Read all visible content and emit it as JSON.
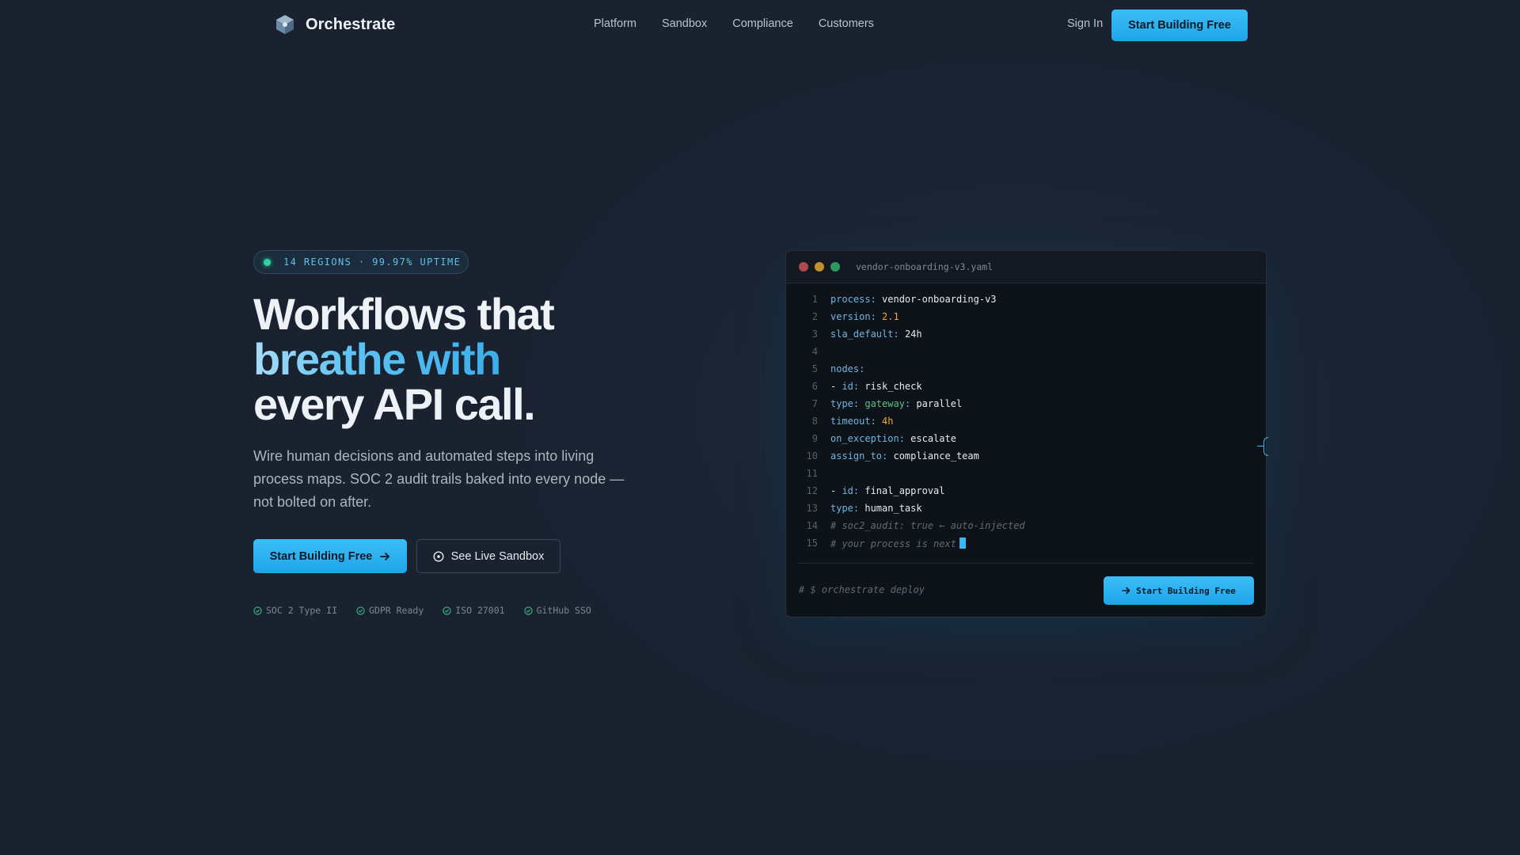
{
  "nav": {
    "brand": "Orchestrate",
    "links": [
      "Platform",
      "Sandbox",
      "Compliance",
      "Customers"
    ],
    "sign_in": "Sign In",
    "cta": "Start Building Free"
  },
  "hero": {
    "badge": "14 REGIONS · 99.97% UPTIME",
    "headline_1": "Workflows that",
    "headline_2": "breathe with",
    "headline_3": "every API call.",
    "subtext": "Wire human decisions and automated steps into living process maps. SOC 2 audit trails baked into every node — not bolted on after.",
    "cta_primary": "Start Building Free",
    "cta_secondary": "See Live Sandbox",
    "trust": [
      "SOC 2 Type II",
      "GDPR Ready",
      "ISO 27001",
      "GitHub SSO"
    ]
  },
  "editor": {
    "file_name": "vendor-onboarding-v3.yaml",
    "lines": [
      {
        "num": "1",
        "key": "process",
        "value": "vendor-onboarding-v3"
      },
      {
        "num": "2",
        "key": "version",
        "value": "2.1"
      },
      {
        "num": "3",
        "key": "sla_default",
        "value": "24h"
      },
      {
        "num": "4"
      },
      {
        "num": "5",
        "key": "nodes"
      },
      {
        "num": "6",
        "key": "id",
        "value": "risk_check"
      },
      {
        "num": "7",
        "key": "type",
        "key2": "gateway",
        "value": "parallel"
      },
      {
        "num": "8",
        "key": "timeout",
        "value": "4h"
      },
      {
        "num": "9",
        "key": "on_exception",
        "value": "escalate"
      },
      {
        "num": "10",
        "key": "assign_to",
        "value": "compliance_team"
      },
      {
        "num": "11"
      },
      {
        "num": "12",
        "key": "id",
        "value": "final_approval"
      },
      {
        "num": "13",
        "key": "type",
        "value": "human_task"
      },
      {
        "num": "14",
        "comment": "# soc2_audit: true ← auto-injected"
      },
      {
        "num": "15",
        "comment": "# your process is next"
      }
    ],
    "deploy_hint": "# $ orchestrate deploy",
    "cta": "Start Building Free"
  },
  "colors": {
    "accent": "#2cb3f0",
    "status_green": "#2fd3a0",
    "background": "#1b2433"
  }
}
